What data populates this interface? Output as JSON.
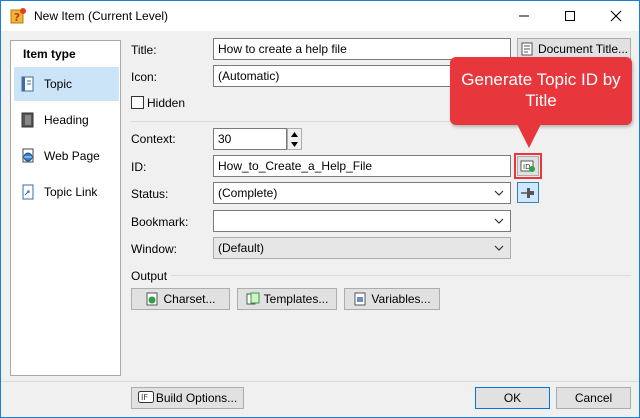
{
  "window": {
    "title": "New Item (Current Level)",
    "accent_color": "#1c7fd6",
    "min_icon": "minimize-icon",
    "max_icon": "maximize-icon",
    "close_icon": "close-icon"
  },
  "sidebar": {
    "header": "Item type",
    "items": [
      {
        "label": "Topic",
        "icon": "topic-icon",
        "selected": true
      },
      {
        "label": "Heading",
        "icon": "heading-icon"
      },
      {
        "label": "Web Page",
        "icon": "web-page-icon"
      },
      {
        "label": "Topic Link",
        "icon": "topic-link-icon"
      }
    ]
  },
  "form": {
    "title_label": "Title:",
    "title_value": "How to create a help file",
    "document_title_button": "Document Title...",
    "icon_label": "Icon:",
    "icon_value": "(Automatic)",
    "hidden_label": "Hidden",
    "context_label": "Context:",
    "context_value": "30",
    "id_label": "ID:",
    "id_value": "How_to_Create_a_Help_File",
    "status_label": "Status:",
    "status_value": "(Complete)",
    "bookmark_label": "Bookmark:",
    "bookmark_value": "",
    "window_label": "Window:",
    "window_value": "(Default)"
  },
  "output": {
    "label": "Output",
    "charset_button": "Charset...",
    "templates_button": "Templates...",
    "variables_button": "Variables..."
  },
  "footer": {
    "build_options_button": "Build Options...",
    "ok_button": "OK",
    "cancel_button": "Cancel"
  },
  "callout": {
    "text_line1": "Generate Topic ID by",
    "text_line2": "Title",
    "color": "#e8363d"
  }
}
